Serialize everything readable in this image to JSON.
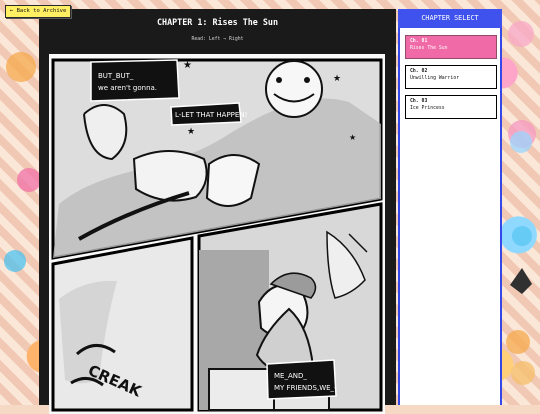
{
  "back": "← Back to Archive",
  "chapter_title": "CHAPTER 1: Rises The Sun",
  "read_hint": "Read: Left → Right",
  "sidebar": {
    "header": "CHAPTER SELECT",
    "chapters": [
      {
        "num": "Ch. 01",
        "name": "Rises The Sun",
        "active": true
      },
      {
        "num": "Ch. 02",
        "name": "Unwilling Warrior",
        "active": false
      },
      {
        "num": "Ch. 03",
        "name": "Ice Princess",
        "active": false
      }
    ]
  },
  "comic": {
    "bubble1_line1": "BUT_BUT_",
    "bubble1_line2": "we aren't gonna.",
    "bubble2": "L-LET THAT HAPPEN!",
    "bubble3_line1": "ME_AND_",
    "bubble3_line2": "MY FRIENDS,WE_-",
    "sfx": "CREAK"
  },
  "colors": {
    "background": "#f6d9c4",
    "reader": "#1a1a1a",
    "sidebar": "#4355ef",
    "active_chapter": "#ef6aa6",
    "back_button": "#ffef63"
  }
}
